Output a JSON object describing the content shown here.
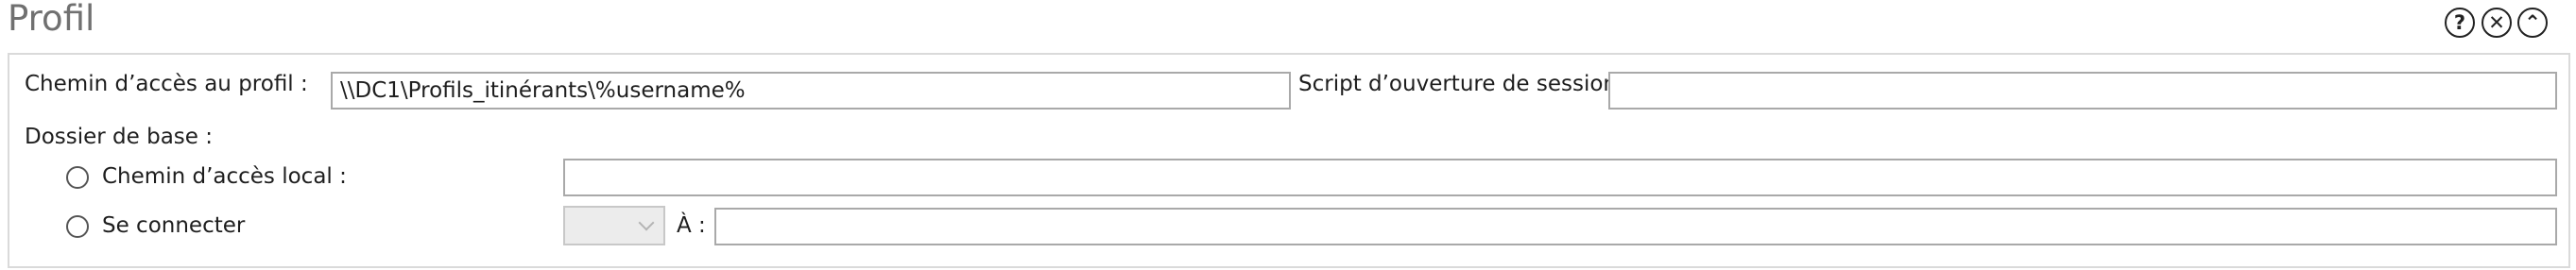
{
  "header": {
    "title": "Profil",
    "help_glyph": "?",
    "close_glyph": "✕",
    "collapse_glyph": "⌃"
  },
  "profile": {
    "profile_path_label": "Chemin d’accès au profil :",
    "profile_path_value": "\\\\DC1\\Profils_itinérants\\%username%",
    "logon_script_label": "Script d’ouverture de session",
    "logon_script_value": ""
  },
  "home_folder": {
    "label": "Dossier de base :",
    "local_path": {
      "label": "Chemin d’accès local :",
      "selected": false,
      "value": ""
    },
    "connect": {
      "label": "Se connecter",
      "selected": false,
      "drive_value": "",
      "to_label": "À :",
      "to_value": ""
    }
  },
  "icons": {
    "help": "help-icon",
    "close": "close-icon",
    "collapse": "chevron-up-icon"
  }
}
